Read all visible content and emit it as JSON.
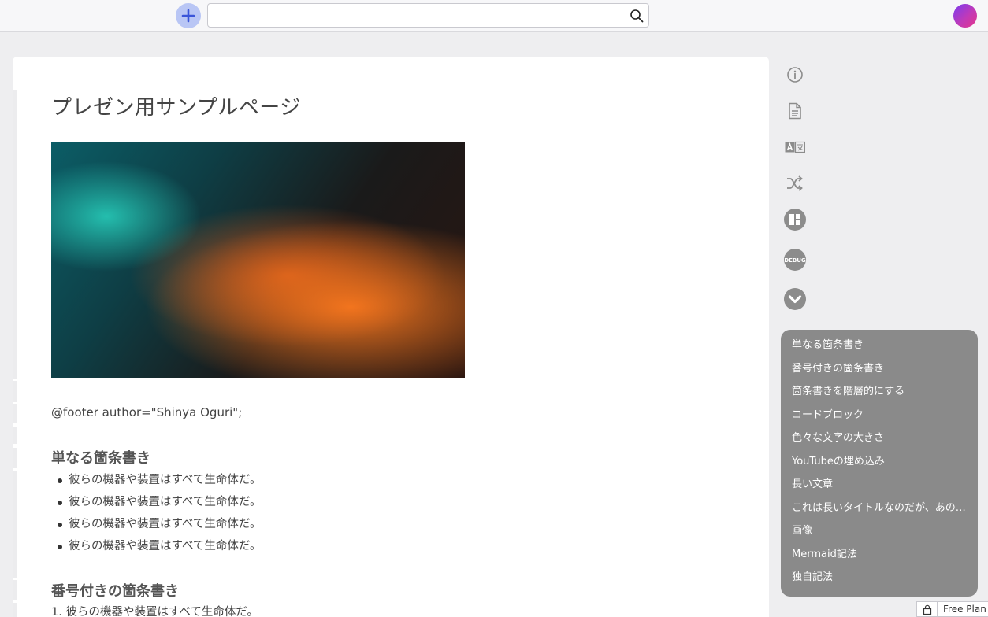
{
  "header": {
    "search_placeholder": "",
    "search_value": "",
    "add_icon": "plus-icon",
    "search_icon": "magnifier-icon"
  },
  "page": {
    "title": "プレゼン用サンプルページ",
    "footer_text": "@footer author=\"Shinya Oguri\";",
    "section1_heading": "単なる箇条書き",
    "bullets": [
      "彼らの機器や装置はすべて生命体だ。",
      "彼らの機器や装置はすべて生命体だ。",
      "彼らの機器や装置はすべて生命体だ。",
      "彼らの機器や装置はすべて生命体だ。"
    ],
    "section2_heading": "番号付きの箇条書き",
    "numbered_first": "1. 彼らの機器や装置はすべて生命体だ。"
  },
  "toolbar": {
    "icons": [
      "info-icon",
      "document-icon",
      "translate-icon",
      "shuffle-icon",
      "layout-icon",
      "debug-icon",
      "chevron-down-icon"
    ],
    "debug_label": "DEBUG"
  },
  "toc": {
    "items": [
      "単なる箇条書き",
      "番号付きの箇条書き",
      "箇条書きを階層的にする",
      "コードブロック",
      "色々な文字の大きさ",
      "YouTubeの埋め込み",
      "長い文章",
      "これは長いタイトルなのだが、あの…",
      "画像",
      "Mermaid記法",
      "独自記法"
    ]
  },
  "plan": {
    "label": "Free Plan"
  },
  "colors": {
    "accent": "#b9c6f5",
    "toc_bg": "#8a8a8a",
    "icon_gray": "#8c8c8c"
  }
}
